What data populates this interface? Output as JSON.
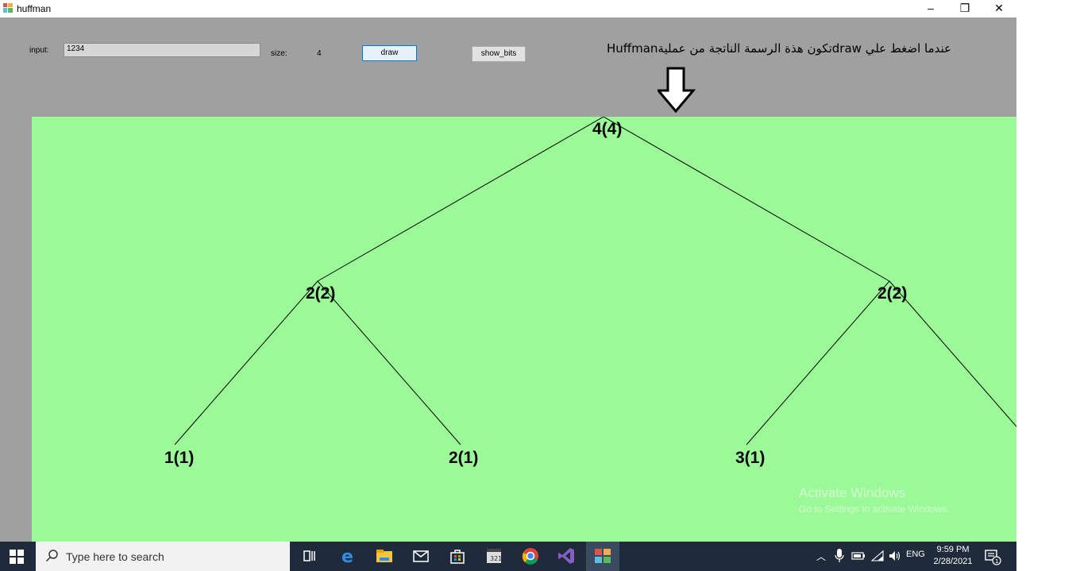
{
  "window": {
    "title": "huffman",
    "min": "–",
    "max": "❐",
    "close": "✕"
  },
  "form": {
    "input_label": "input:",
    "input_value": "1234",
    "size_label": "size:",
    "size_value": "4",
    "draw_label": "draw",
    "show_bits_label": "show_bits",
    "annotation": "عندما اضغط علي drawتكون هذة الرسمة الناتجة من عمليةHuffman"
  },
  "tree": {
    "background": "#9bfa97",
    "nodes": [
      {
        "id": "root",
        "label": "4(4)"
      },
      {
        "id": "left",
        "label": "2(2)"
      },
      {
        "id": "right",
        "label": "2(2)"
      },
      {
        "id": "ll",
        "label": "1(1)"
      },
      {
        "id": "lr",
        "label": "2(1)"
      },
      {
        "id": "rl",
        "label": "3(1)"
      }
    ]
  },
  "watermark": {
    "line1": "Activate Windows",
    "line2": "Go to Settings to activate Windows."
  },
  "taskbar": {
    "search_placeholder": "Type here to search",
    "lang": "ENG",
    "time": "9:59 PM",
    "date": "2/28/2021",
    "notif_count": "1"
  }
}
